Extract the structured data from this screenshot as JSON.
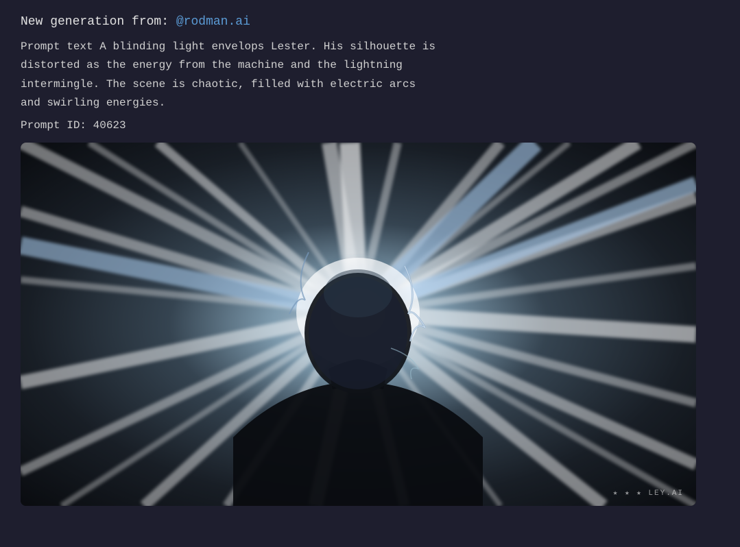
{
  "header": {
    "new_generation_label": "New generation from:",
    "mention": "@rodman.ai"
  },
  "prompt": {
    "label": "Prompt text",
    "text": "A blinding light envelops Lester. His silhouette is distorted as the energy from the machine and the lightning intermingle. The scene is chaotic, filled with electric arcs and swirling energies.",
    "id_label": "Prompt ID:",
    "id_value": "40623"
  },
  "image": {
    "alt": "AI generated image of a silhouette with blinding light and electric arcs",
    "watermark": "★ ★ ★ LEY.AI"
  }
}
